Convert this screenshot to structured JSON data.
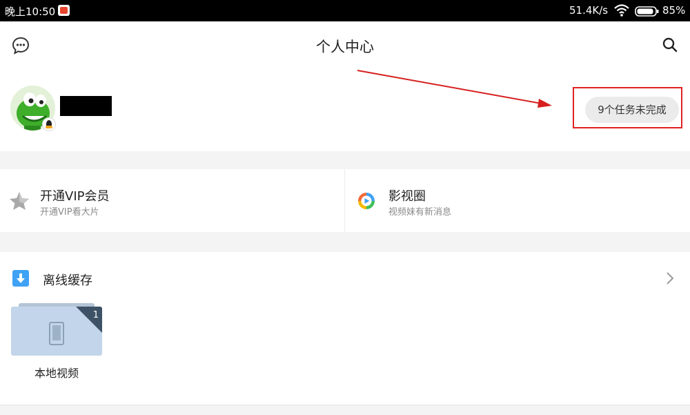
{
  "status_bar": {
    "time": "晚上10:50",
    "network_speed": "51.4K/s",
    "battery": "85%",
    "icons": [
      "app-notification-icon",
      "wifi-icon",
      "battery-icon"
    ]
  },
  "header": {
    "title": "个人中心",
    "left_icon": "message-icon",
    "right_icon": "search-icon"
  },
  "profile": {
    "task_button_label": "9个任务未完成"
  },
  "features": {
    "vip": {
      "title": "开通VIP会员",
      "subtitle": "开通VIP看大片",
      "icon": "star-icon"
    },
    "circle": {
      "title": "影视圈",
      "subtitle": "视频妹有新消息",
      "icon": "play-circle-icon"
    }
  },
  "offline": {
    "title": "离线缓存",
    "icon": "download-icon",
    "folder": {
      "label": "本地视频",
      "count": "1"
    }
  },
  "colors": {
    "highlight_red": "#e02020",
    "accent_blue": "#3fa2f4",
    "page_bg": "#f4f4f4"
  }
}
